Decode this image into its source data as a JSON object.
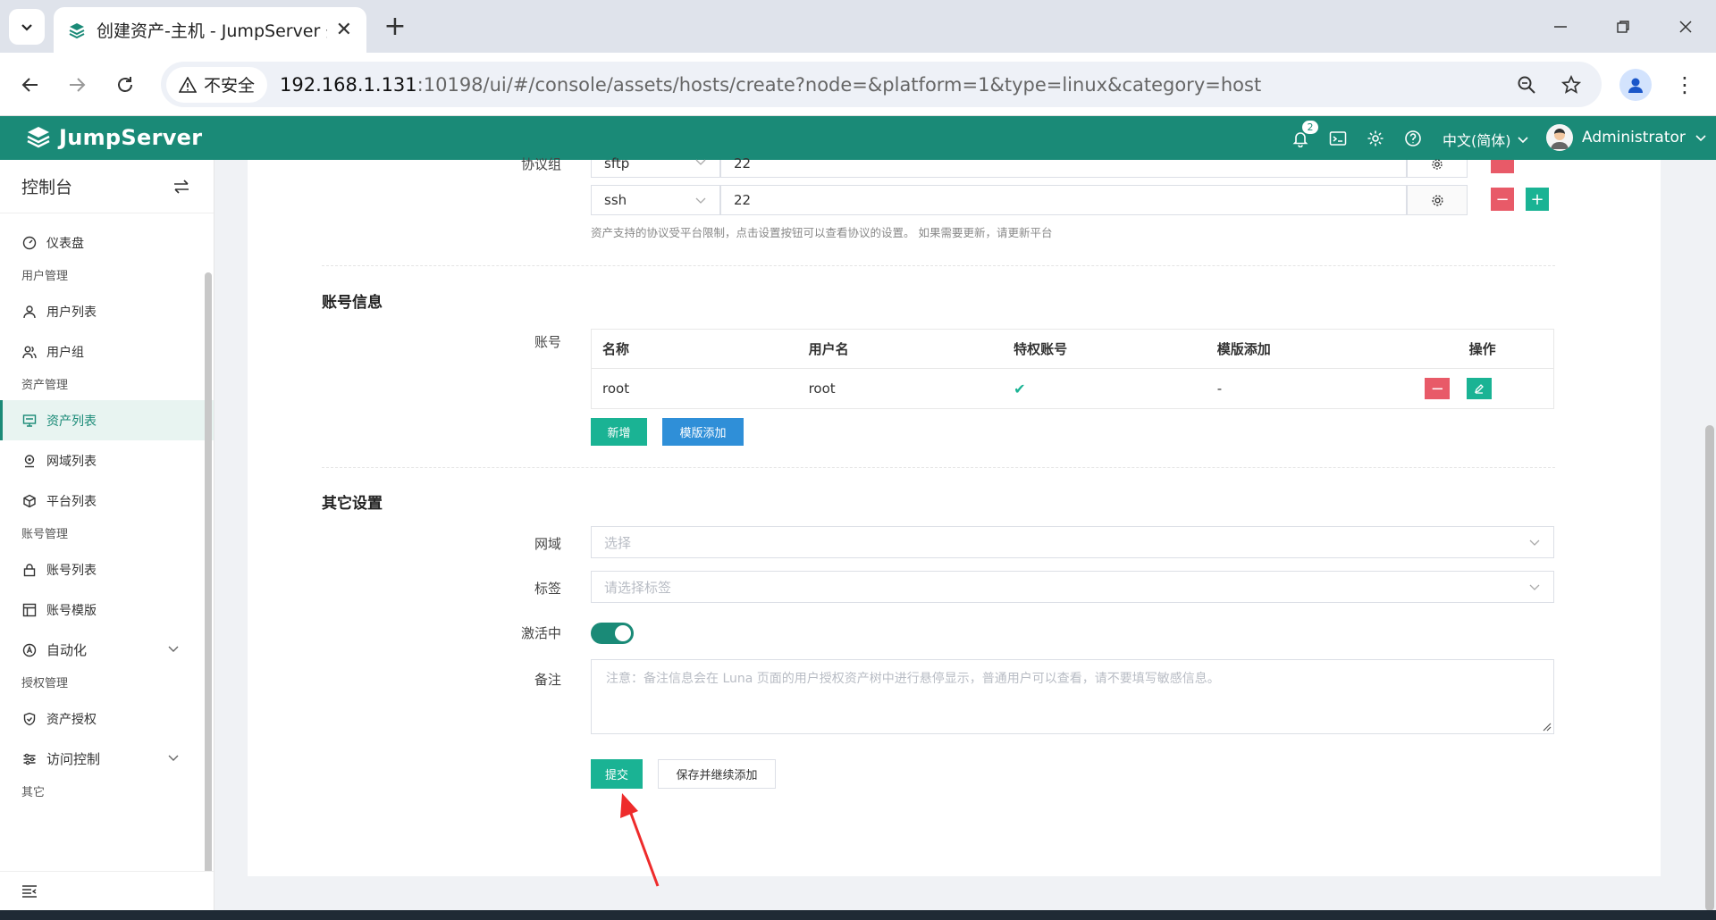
{
  "browser": {
    "tab_title": "创建资产-主机 - JumpServer 开",
    "security_label": "不安全",
    "url_host": "192.168.1.131",
    "url_rest": ":10198/ui/#/console/assets/hosts/create?node=&platform=1&type=linux&category=host"
  },
  "header": {
    "brand": "JumpServer",
    "notification_count": "2",
    "language": "中文(简体)",
    "username": "Administrator",
    "accent_color": "#1a8a77"
  },
  "sidebar": {
    "title": "控制台",
    "groups": [
      {
        "label": "",
        "items": [
          {
            "label": "仪表盘",
            "icon": "dashboard-icon"
          }
        ]
      },
      {
        "label": "用户管理",
        "items": [
          {
            "label": "用户列表",
            "icon": "user-icon"
          },
          {
            "label": "用户组",
            "icon": "user-group-icon"
          }
        ]
      },
      {
        "label": "资产管理",
        "items": [
          {
            "label": "资产列表",
            "icon": "asset-list-icon",
            "active": true
          },
          {
            "label": "网域列表",
            "icon": "domain-icon"
          },
          {
            "label": "平台列表",
            "icon": "platform-icon"
          }
        ]
      },
      {
        "label": "账号管理",
        "items": [
          {
            "label": "账号列表",
            "icon": "account-icon"
          },
          {
            "label": "账号模版",
            "icon": "template-icon"
          },
          {
            "label": "自动化",
            "icon": "automation-icon",
            "expandable": true
          }
        ]
      },
      {
        "label": "授权管理",
        "items": [
          {
            "label": "资产授权",
            "icon": "permission-icon"
          },
          {
            "label": "访问控制",
            "icon": "access-control-icon",
            "expandable": true
          }
        ]
      },
      {
        "label": "其它",
        "items": []
      }
    ]
  },
  "protocols": {
    "label": "协议组",
    "rows": [
      {
        "name": "sftp",
        "port": "22"
      },
      {
        "name": "ssh",
        "port": "22"
      }
    ],
    "hint": "资产支持的协议受平台限制，点击设置按钮可以查看协议的设置。 如果需要更新，请更新平台"
  },
  "accounts": {
    "section_title": "账号信息",
    "label": "账号",
    "columns": [
      "名称",
      "用户名",
      "特权账号",
      "模版添加",
      "操作"
    ],
    "rows": [
      {
        "name": "root",
        "username": "root",
        "privileged": "✔",
        "template": "-"
      }
    ],
    "add_button": "新增",
    "template_button": "模版添加"
  },
  "other": {
    "section_title": "其它设置",
    "domain_label": "网域",
    "domain_placeholder": "选择",
    "labels_label": "标签",
    "labels_placeholder": "请选择标签",
    "active_label": "激活中",
    "active": true,
    "comment_label": "备注",
    "comment_placeholder": "注意：备注信息会在 Luna 页面的用户授权资产树中进行悬停显示，普通用户可以查看，请不要填写敏感信息。"
  },
  "actions": {
    "submit": "提交",
    "save_continue": "保存并继续添加"
  }
}
